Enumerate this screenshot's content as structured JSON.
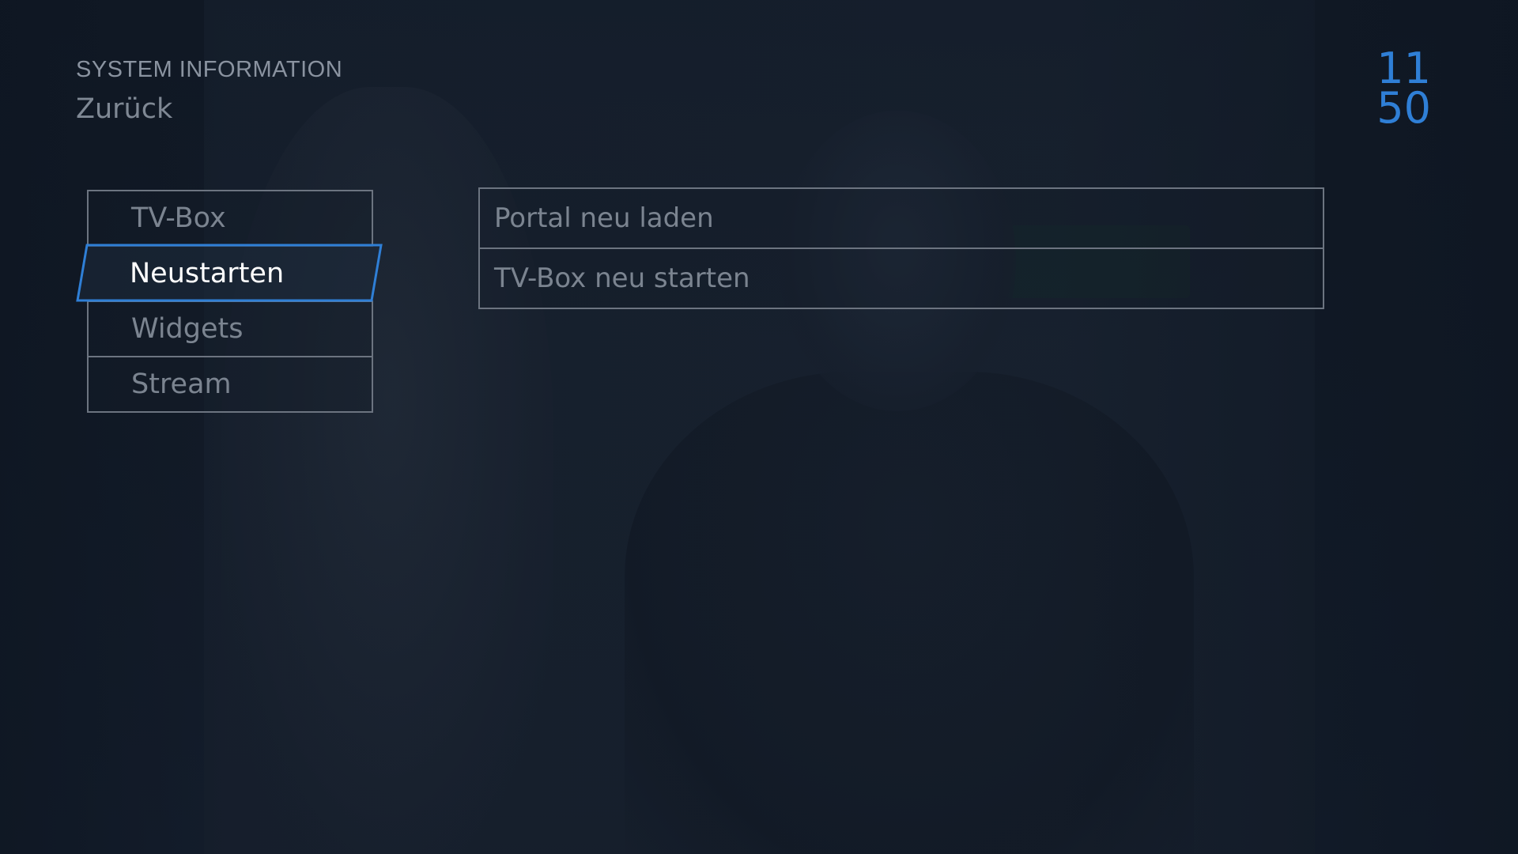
{
  "header": {
    "section_title": "SYSTEM INFORMATION",
    "back_label": "Zurück"
  },
  "clock": {
    "hours": "11",
    "minutes": "50"
  },
  "menu": {
    "items": [
      {
        "label": "TV-Box",
        "active": false
      },
      {
        "label": "Neustarten",
        "active": true
      },
      {
        "label": "Widgets",
        "active": false
      },
      {
        "label": "Stream",
        "active": false
      }
    ]
  },
  "options": {
    "items": [
      {
        "label": "Portal neu laden"
      },
      {
        "label": "TV-Box neu starten"
      }
    ]
  },
  "colors": {
    "accent": "#2f7fd6",
    "text_dim": "#7b8490",
    "text_active": "#ffffff",
    "border": "#6c7480",
    "background": "#121a26"
  }
}
